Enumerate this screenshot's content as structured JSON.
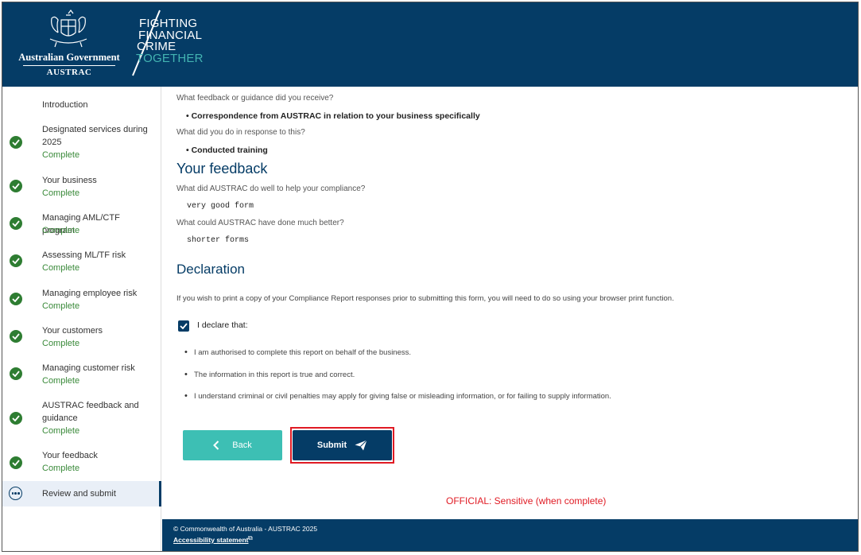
{
  "header": {
    "gov_name": "Australian Government",
    "agency": "AUSTRAC",
    "tagline_lines": [
      "FIGHTING",
      "FINANCIAL",
      "CRIME",
      "TOGETHER"
    ],
    "brand_color": "#053c66",
    "accent_teal": "#43b4b2"
  },
  "sidebar": {
    "items": [
      {
        "label": "Introduction",
        "status": ""
      },
      {
        "label": "Designated services during 2025",
        "status": "Complete"
      },
      {
        "label": "Your business",
        "status": "Complete"
      },
      {
        "label": "Managing AML/CTF program",
        "status": "Complete"
      },
      {
        "label": "Assessing ML/TF risk",
        "status": "Complete"
      },
      {
        "label": "Managing employee risk",
        "status": "Complete"
      },
      {
        "label": "Your customers",
        "status": "Complete"
      },
      {
        "label": "Managing customer risk",
        "status": "Complete"
      },
      {
        "label": "AUSTRAC feedback and guidance",
        "status": "Complete"
      },
      {
        "label": "Your feedback",
        "status": "Complete"
      },
      {
        "label": "Review and submit",
        "status": ""
      }
    ]
  },
  "main": {
    "q1": "What feedback or guidance did you receive?",
    "a1": "• Correspondence from AUSTRAC in relation to your business specifically",
    "q2": "What did you do in response to this?",
    "a2": "• Conducted training",
    "feedback_heading": "Your feedback",
    "q3": "What did AUSTRAC do well to help your compliance?",
    "a3": "very good form",
    "q4": "What could AUSTRAC have done much better?",
    "a4": "shorter forms",
    "declaration_heading": "Declaration",
    "print_note": "If you wish to print a copy of your Compliance Report responses prior to submitting this form, you will need to do so using your browser print function.",
    "declare_label": "I declare that:",
    "declare_checked": true,
    "bullets": [
      "I am authorised to complete this report on behalf of the business.",
      "The information in this report is true and correct.",
      "I understand criminal or civil penalties may apply for giving false or misleading information, or for failing to supply information."
    ],
    "back_label": "Back",
    "submit_label": "Submit",
    "classification": "OFFICIAL: Sensitive (when complete)"
  },
  "footer": {
    "copyright": "© Commonwealth of Australia - AUSTRAC 2025",
    "accessibility": "Accessibility statement"
  }
}
